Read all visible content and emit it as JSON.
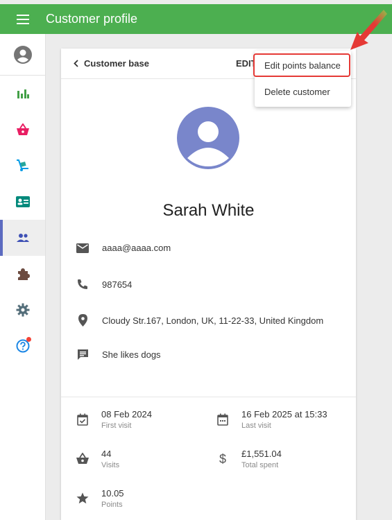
{
  "app": {
    "title": "Customer profile"
  },
  "colors": {
    "appbar": "#4caf50",
    "accent": "#5c6bc0",
    "avatar_bg": "#7986cb",
    "highlight": "#e53935"
  },
  "sidebar": {
    "items": [
      {
        "icon": "account-circle-icon",
        "active": false
      },
      {
        "icon": "bar-chart-icon",
        "active": false
      },
      {
        "icon": "basket-icon",
        "active": false
      },
      {
        "icon": "hand-truck-icon",
        "active": false
      },
      {
        "icon": "contact-card-icon",
        "active": false
      },
      {
        "icon": "people-icon",
        "active": true
      },
      {
        "icon": "puzzle-icon",
        "active": false
      },
      {
        "icon": "gear-icon",
        "active": false
      },
      {
        "icon": "help-icon",
        "active": false,
        "notification": true
      }
    ]
  },
  "header": {
    "back_label": "Customer base",
    "edit_label": "EDIT"
  },
  "menu": {
    "items": [
      "Edit points balance",
      "Delete customer"
    ],
    "highlighted_index": 0
  },
  "customer": {
    "name": "Sarah White",
    "email": "aaaa@aaaa.com",
    "phone": "987654",
    "address": "Cloudy Str.167, London, UK, 11-22-33, United Kingdom",
    "note": "She likes dogs"
  },
  "stats": {
    "first_visit": {
      "value": "08 Feb 2024",
      "label": "First visit"
    },
    "last_visit": {
      "value": "16 Feb 2025 at 15:33",
      "label": "Last visit"
    },
    "visits": {
      "value": "44",
      "label": "Visits"
    },
    "total_spent": {
      "value": "£1,551.04",
      "label": "Total spent"
    },
    "points": {
      "value": "10.05",
      "label": "Points"
    }
  }
}
